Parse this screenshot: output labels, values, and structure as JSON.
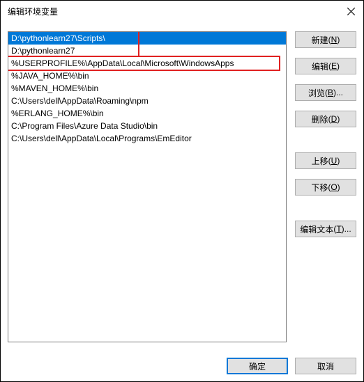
{
  "window": {
    "title": "编辑环境变量"
  },
  "list": {
    "items": [
      "D:\\pythonlearn27\\Scripts\\",
      "D:\\pythonlearn27",
      "%USERPROFILE%\\AppData\\Local\\Microsoft\\WindowsApps",
      "%JAVA_HOME%\\bin",
      "%MAVEN_HOME%\\bin",
      "C:\\Users\\dell\\AppData\\Roaming\\npm",
      "%ERLANG_HOME%\\bin",
      "C:\\Program Files\\Azure Data Studio\\bin",
      "C:\\Users\\dell\\AppData\\Local\\Programs\\EmEditor"
    ],
    "selected_index": 0
  },
  "buttons": {
    "new": {
      "label": "新建",
      "accel": "N"
    },
    "edit": {
      "label": "编辑",
      "accel": "E"
    },
    "browse": {
      "label": "浏览",
      "accel": "B",
      "suffix": "..."
    },
    "delete": {
      "label": "删除",
      "accel": "D"
    },
    "move_up": {
      "label": "上移",
      "accel": "U"
    },
    "move_down": {
      "label": "下移",
      "accel": "O"
    },
    "edit_text": {
      "label": "编辑文本",
      "accel": "T",
      "suffix": "..."
    },
    "ok": {
      "label": "确定"
    },
    "cancel": {
      "label": "取消"
    }
  }
}
